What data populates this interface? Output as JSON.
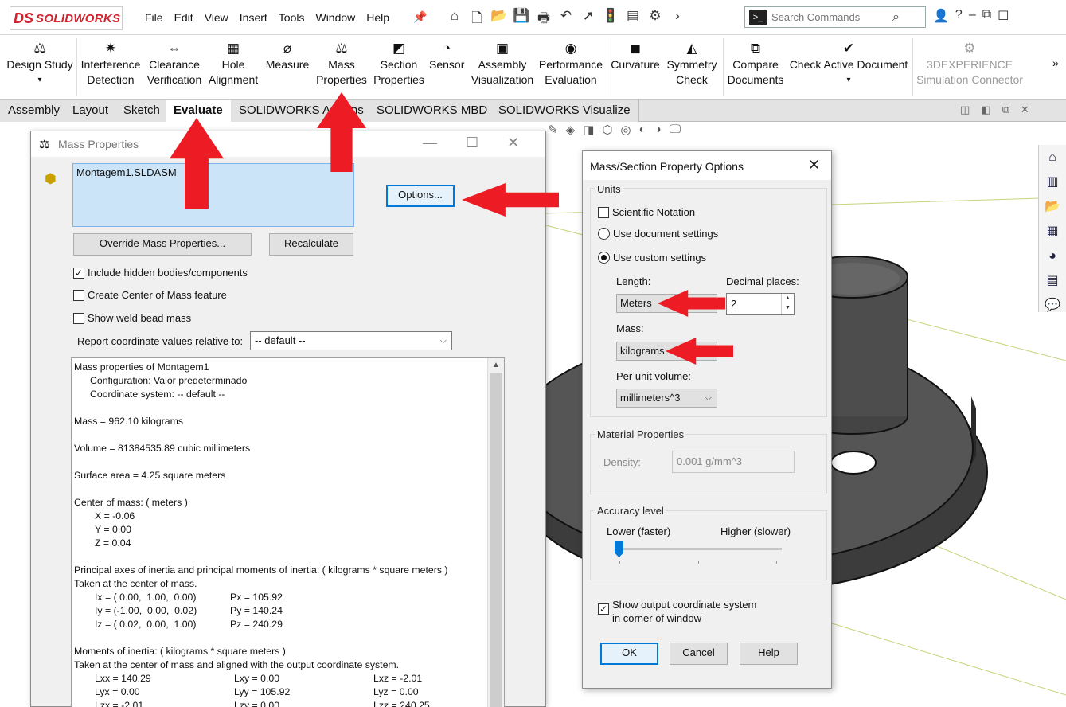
{
  "app": {
    "logo_mark": "DS",
    "logo_text": "SOLIDWORKS",
    "menus": [
      "File",
      "Edit",
      "View",
      "Insert",
      "Tools",
      "Window",
      "Help"
    ],
    "search_placeholder": "Search Commands"
  },
  "ribbon": [
    {
      "id": "design-study",
      "icon": "design-study-icon",
      "glyph": "⚖",
      "line1": "Design Study",
      "line2": "",
      "dropdown": true
    },
    {
      "id": "interference-detection",
      "icon": "interference-detection-icon",
      "glyph": "✷",
      "line1": "Interference",
      "line2": "Detection"
    },
    {
      "id": "clearance-verification",
      "icon": "clearance-verification-icon",
      "glyph": "⇔",
      "line1": "Clearance",
      "line2": "Verification"
    },
    {
      "id": "hole-alignment",
      "icon": "hole-alignment-icon",
      "glyph": "▦",
      "line1": "Hole",
      "line2": "Alignment"
    },
    {
      "id": "measure",
      "icon": "measure-icon",
      "glyph": "⌀",
      "line1": "Measure",
      "line2": ""
    },
    {
      "id": "mass-properties",
      "icon": "mass-properties-icon",
      "glyph": "⚖",
      "line1": "Mass",
      "line2": "Properties"
    },
    {
      "id": "section-properties",
      "icon": "section-properties-icon",
      "glyph": "◩",
      "line1": "Section",
      "line2": "Properties"
    },
    {
      "id": "sensor",
      "icon": "sensor-icon",
      "glyph": "◔",
      "line1": "Sensor",
      "line2": ""
    },
    {
      "id": "assembly-visualization",
      "icon": "assembly-visualization-icon",
      "glyph": "▣",
      "line1": "Assembly",
      "line2": "Visualization"
    },
    {
      "id": "performance-evaluation",
      "icon": "performance-evaluation-icon",
      "glyph": "◉",
      "line1": "Performance",
      "line2": "Evaluation"
    },
    {
      "id": "curvature",
      "icon": "curvature-icon",
      "glyph": "◼",
      "line1": "Curvature",
      "line2": ""
    },
    {
      "id": "symmetry-check",
      "icon": "symmetry-check-icon",
      "glyph": "◭",
      "line1": "Symmetry",
      "line2": "Check"
    },
    {
      "id": "compare-documents",
      "icon": "compare-documents-icon",
      "glyph": "⧉",
      "line1": "Compare",
      "line2": "Documents"
    },
    {
      "id": "check-active-document",
      "icon": "check-active-document-icon",
      "glyph": "✔",
      "line1": "Check Active Document",
      "line2": "",
      "dropdown": true
    },
    {
      "id": "3dexperience-simulation-connector",
      "icon": "simulation-connector-icon",
      "glyph": "⚙",
      "line1": "3DEXPERIENCE",
      "line2": "Simulation Connector",
      "disabled": true
    }
  ],
  "tabs": [
    {
      "label": "Assembly",
      "active": false
    },
    {
      "label": "Layout",
      "active": false
    },
    {
      "label": "Sketch",
      "active": false
    },
    {
      "label": "Evaluate",
      "active": true
    },
    {
      "label": "SOLIDWORKS Add-Ins",
      "active": false
    },
    {
      "label": "SOLIDWORKS MBD",
      "active": false
    },
    {
      "label": "SOLIDWORKS Visualize",
      "active": false
    }
  ],
  "mass_dialog": {
    "title": "Mass Properties",
    "selected_item": "Montagem1.SLDASM",
    "options_button": "Options...",
    "override_button": "Override Mass Properties...",
    "recalculate_button": "Recalculate",
    "include_hidden": {
      "label": "Include hidden bodies/components",
      "checked": true
    },
    "create_com": {
      "label": "Create Center of Mass feature",
      "checked": false
    },
    "show_weld": {
      "label": "Show weld bead mass",
      "checked": false
    },
    "report_coord_label": "Report coordinate values relative to:",
    "report_coord_value": "-- default --",
    "report": {
      "header": "Mass properties of Montagem1",
      "configuration": "Configuration: Valor predeterminado",
      "coordinate_system": "Coordinate system: -- default --",
      "mass": "Mass = 962.10 kilograms",
      "volume": "Volume = 81384535.89 cubic millimeters",
      "surface_area": "Surface area = 4.25 square meters",
      "com_header": "Center of mass: ( meters )",
      "com_x": "X = -0.06",
      "com_y": "Y = 0.00",
      "com_z": "Z = 0.04",
      "principal_header": "Principal axes of inertia and principal moments of inertia: ( kilograms * square meters )",
      "principal_sub": "Taken at the center of mass.",
      "principal_rows": [
        {
          "axis": "Ix = ( 0.00,  1.00,  0.00)",
          "moment": "Px = 105.92"
        },
        {
          "axis": "Iy = (-1.00,  0.00,  0.02)",
          "moment": "Py = 140.24"
        },
        {
          "axis": "Iz = ( 0.02,  0.00,  1.00)",
          "moment": "Pz = 240.29"
        }
      ],
      "moments_header": "Moments of inertia: ( kilograms * square meters )",
      "moments_sub": "Taken at the center of mass and aligned with the output coordinate system.",
      "moments_rows": [
        {
          "a": "Lxx = 140.29",
          "b": "Lxy = 0.00",
          "c": "Lxz = -2.01"
        },
        {
          "a": "Lyx = 0.00",
          "b": "Lyy = 105.92",
          "c": "Lyz = 0.00"
        },
        {
          "a": "Lzx = -2.01",
          "b": "Lzy = 0.00",
          "c": "Lzz = 240.25"
        }
      ]
    }
  },
  "options_dialog": {
    "title": "Mass/Section Property Options",
    "units_group": "Units",
    "scientific_notation": {
      "label": "Scientific Notation",
      "checked": false
    },
    "use_document_settings": "Use document settings",
    "use_custom_settings": "Use custom settings",
    "length_label": "Length:",
    "length_value": "Meters",
    "decimal_label": "Decimal places:",
    "decimal_value": "2",
    "mass_label": "Mass:",
    "mass_value": "kilograms",
    "per_unit_volume_label": "Per unit volume:",
    "per_unit_volume_value": "millimeters^3",
    "material_group": "Material Properties",
    "density_label": "Density:",
    "density_value": "0.001 g/mm^3",
    "accuracy_group": "Accuracy level",
    "accuracy_low": "Lower (faster)",
    "accuracy_high": "Higher (slower)",
    "accuracy_level": 0,
    "show_output_coord": {
      "line1": "Show output coordinate system",
      "line2": "in corner of window",
      "checked": true
    },
    "ok": "OK",
    "cancel": "Cancel",
    "help": "Help"
  },
  "colors": {
    "accent": "#0078d7",
    "annotation_arrow": "#ed1c24",
    "selection": "#cce4f7",
    "brand": "#d2242e",
    "part": "#4a4a4a"
  }
}
